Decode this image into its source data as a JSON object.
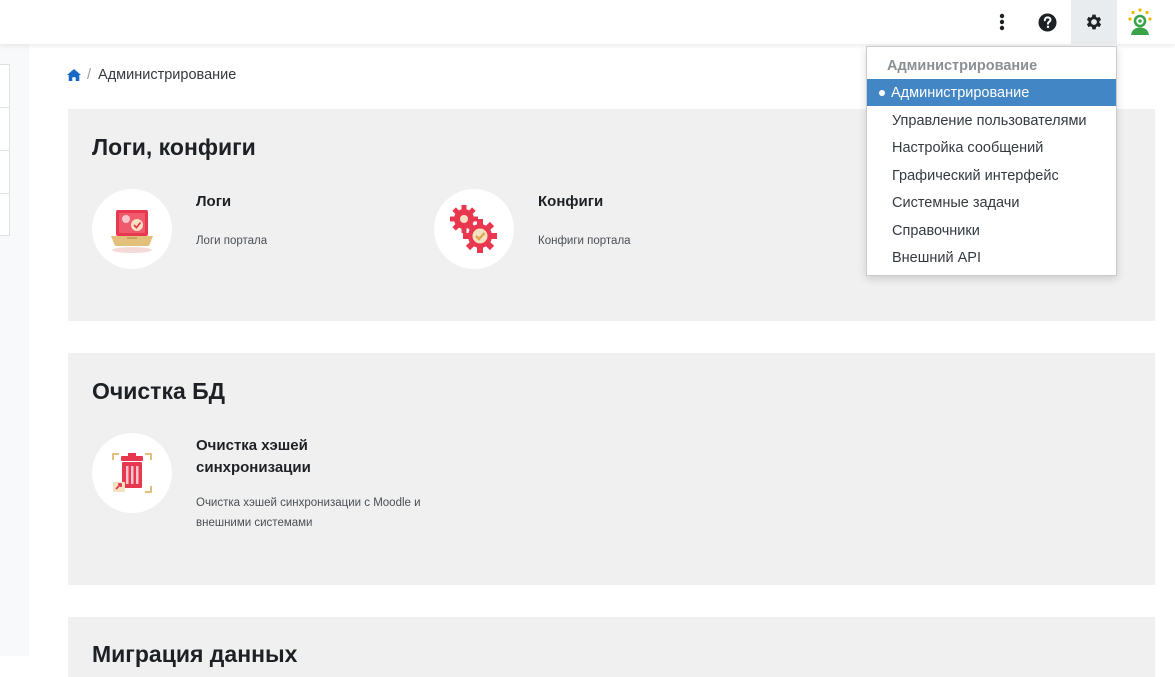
{
  "navbar": {
    "icons": [
      "kebab-menu-icon",
      "help-icon",
      "gear-icon",
      "user-avatar-icon"
    ]
  },
  "breadcrumb": {
    "home_icon": "home-icon",
    "separator": "/",
    "current": "Администрирование"
  },
  "sections": [
    {
      "title": "Логи, конфиги",
      "tiles": [
        {
          "name": "Логи",
          "description": "Логи портала",
          "icon": "logs-laptop-icon"
        },
        {
          "name": "Конфиги",
          "description": "Конфиги портала",
          "icon": "configs-gears-icon"
        }
      ]
    },
    {
      "title": "Очистка БД",
      "tiles": [
        {
          "name": "Очистка хэшей синхронизации",
          "description": "Очистка хэшей синхронизации с Moodle и внешними системами",
          "icon": "trash-bin-icon"
        }
      ]
    },
    {
      "title": "Миграция данных",
      "tiles": []
    }
  ],
  "settings_menu": {
    "header": "Администрирование",
    "items": [
      {
        "label": "Администрирование",
        "active": true
      },
      {
        "label": "Управление пользователями",
        "active": false
      },
      {
        "label": "Настройка сообщений",
        "active": false
      },
      {
        "label": "Графический интерфейс",
        "active": false
      },
      {
        "label": "Системные задачи",
        "active": false
      },
      {
        "label": "Справочники",
        "active": false
      },
      {
        "label": "Внешний API",
        "active": false
      }
    ]
  },
  "colors": {
    "accent": "#4286c6",
    "card_bg": "#f0f0f0",
    "icon_red": "#e8384f",
    "icon_gold": "#e2bf7b",
    "avatar_green": "#3aa34a"
  }
}
